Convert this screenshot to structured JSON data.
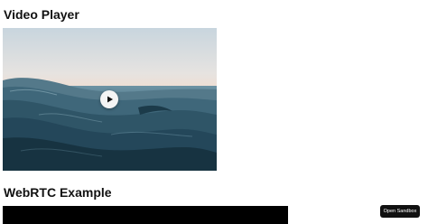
{
  "video_section": {
    "title": "Video Player"
  },
  "webrtc_section": {
    "title": "WebRTC Example"
  },
  "sandbox": {
    "button_label": "Open Sandbox"
  },
  "icons": {
    "play": "play-icon"
  },
  "colors": {
    "sky_top": "#c9d6df",
    "sky_horizon": "#f0ddd0",
    "sea_far": "#5f8799",
    "sea_mid": "#3b6377",
    "sea_near": "#1c3a4a",
    "webrtc_background": "#000000",
    "sandbox_button": "#111111"
  }
}
